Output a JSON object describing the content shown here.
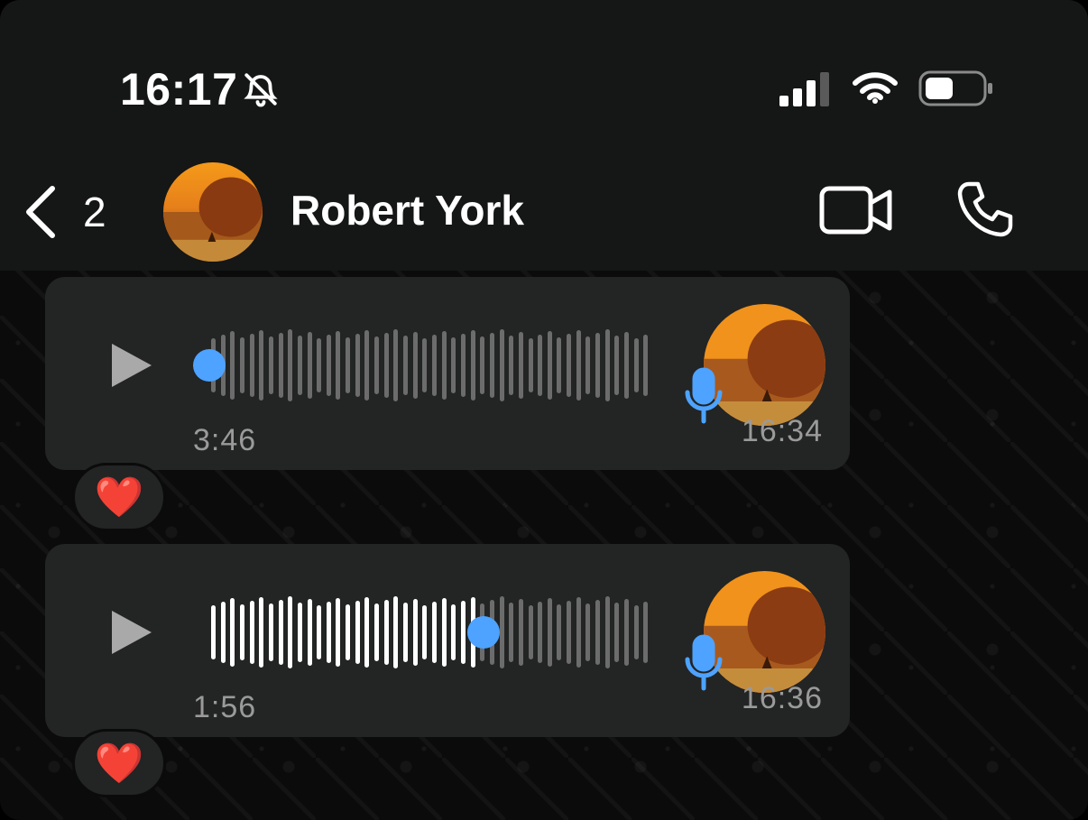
{
  "status_bar": {
    "time": "16:17",
    "icons": [
      "bell-slash-icon",
      "signal-icon",
      "wifi-icon",
      "battery-icon"
    ]
  },
  "header": {
    "back_count": "2",
    "contact_name": "Robert York",
    "icons": [
      "back-chevron-icon",
      "video-call-icon",
      "voice-call-icon"
    ]
  },
  "messages": [
    {
      "type": "voice",
      "duration": "3:46",
      "time": "16:34",
      "played_fraction": 0.0,
      "reaction": "❤️"
    },
    {
      "type": "voice",
      "duration": "1:56",
      "time": "16:36",
      "played_fraction": 0.62,
      "reaction": "❤️"
    }
  ],
  "colors": {
    "accent": "#4da3ff",
    "bubble": "#232424",
    "header": "#151616",
    "played_bar": "#ffffff",
    "unplayed_bar": "#6c6c6c"
  }
}
